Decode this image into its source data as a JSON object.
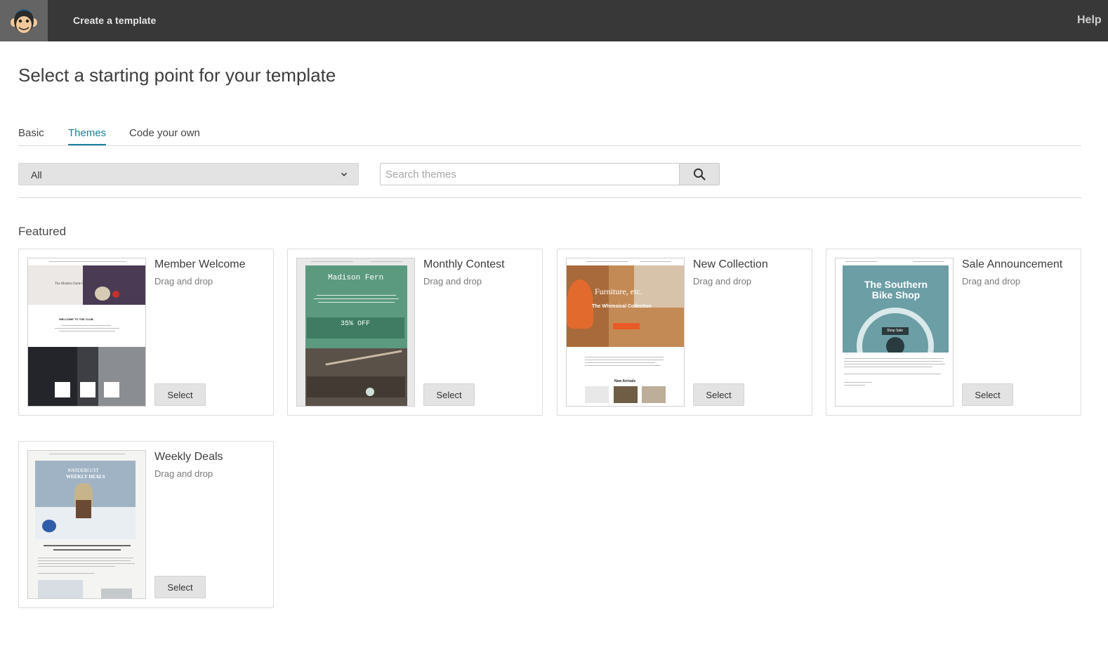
{
  "topbar": {
    "title": "Create a template",
    "help": "Help",
    "logo_icon": "monkey-logo-icon"
  },
  "page": {
    "title": "Select a starting point for your template"
  },
  "tabs": [
    {
      "label": "Basic",
      "active": false
    },
    {
      "label": "Themes",
      "active": true
    },
    {
      "label": "Code your own",
      "active": false
    }
  ],
  "filter": {
    "selected": "All",
    "icon": "chevron-down-icon"
  },
  "search": {
    "placeholder": "Search themes",
    "value": "",
    "icon": "search-icon"
  },
  "featured": {
    "title": "Featured",
    "cards": [
      {
        "name": "Member Welcome",
        "type": "Drag and drop",
        "button": "Select",
        "thumb_text": [
          "The Modern Dude Clothing Store",
          "WELCOME TO THE CLUB"
        ]
      },
      {
        "name": "Monthly Contest",
        "type": "Drag and drop",
        "button": "Select",
        "thumb_text": [
          "Madison Fern",
          "35% OFF"
        ]
      },
      {
        "name": "New Collection",
        "type": "Drag and drop",
        "button": "Select",
        "thumb_text": [
          "Furniture, etc.",
          "The Whimsical Collection",
          "New Arrivals"
        ]
      },
      {
        "name": "Sale Announcement",
        "type": "Drag and drop",
        "button": "Select",
        "thumb_text": [
          "The Southern Bike Shop",
          "Shop Sale"
        ]
      },
      {
        "name": "Weekly Deals",
        "type": "Drag and drop",
        "button": "Select",
        "thumb_text": [
          "WANDERLUST",
          "WEEKLY DEALS"
        ]
      }
    ]
  },
  "colors": {
    "topbar": "#383838",
    "accent": "#1a7f9c",
    "button": "#e3e3e3"
  }
}
